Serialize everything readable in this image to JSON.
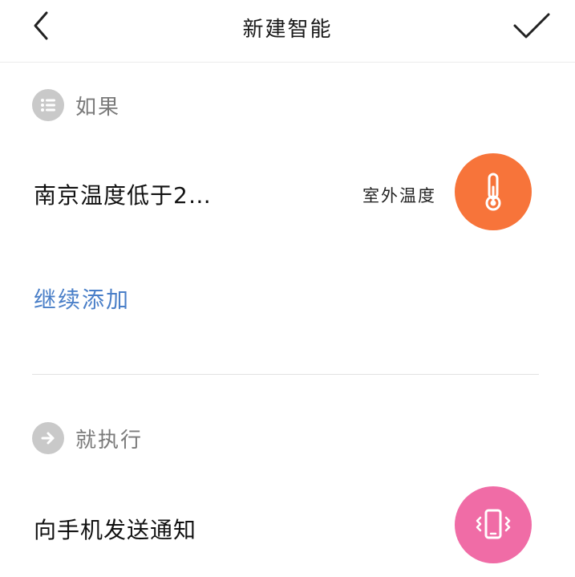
{
  "header": {
    "title": "新建智能",
    "back_icon": "chevron-left-icon",
    "confirm_icon": "checkmark-icon"
  },
  "if_section": {
    "label": "如果",
    "icon": "list-icon",
    "condition": {
      "title": "南京温度低于2…",
      "type_label": "室外温度",
      "icon": "thermometer-icon",
      "icon_color": "#f7743a"
    },
    "add_more_label": "继续添加"
  },
  "then_section": {
    "label": "就执行",
    "icon": "arrow-right-icon",
    "action": {
      "title": "向手机发送通知",
      "icon": "phone-vibrate-icon",
      "icon_color": "#f06ca6"
    }
  },
  "colors": {
    "link": "#4a7fc8",
    "section_icon_bg": "#c9c9c9"
  }
}
